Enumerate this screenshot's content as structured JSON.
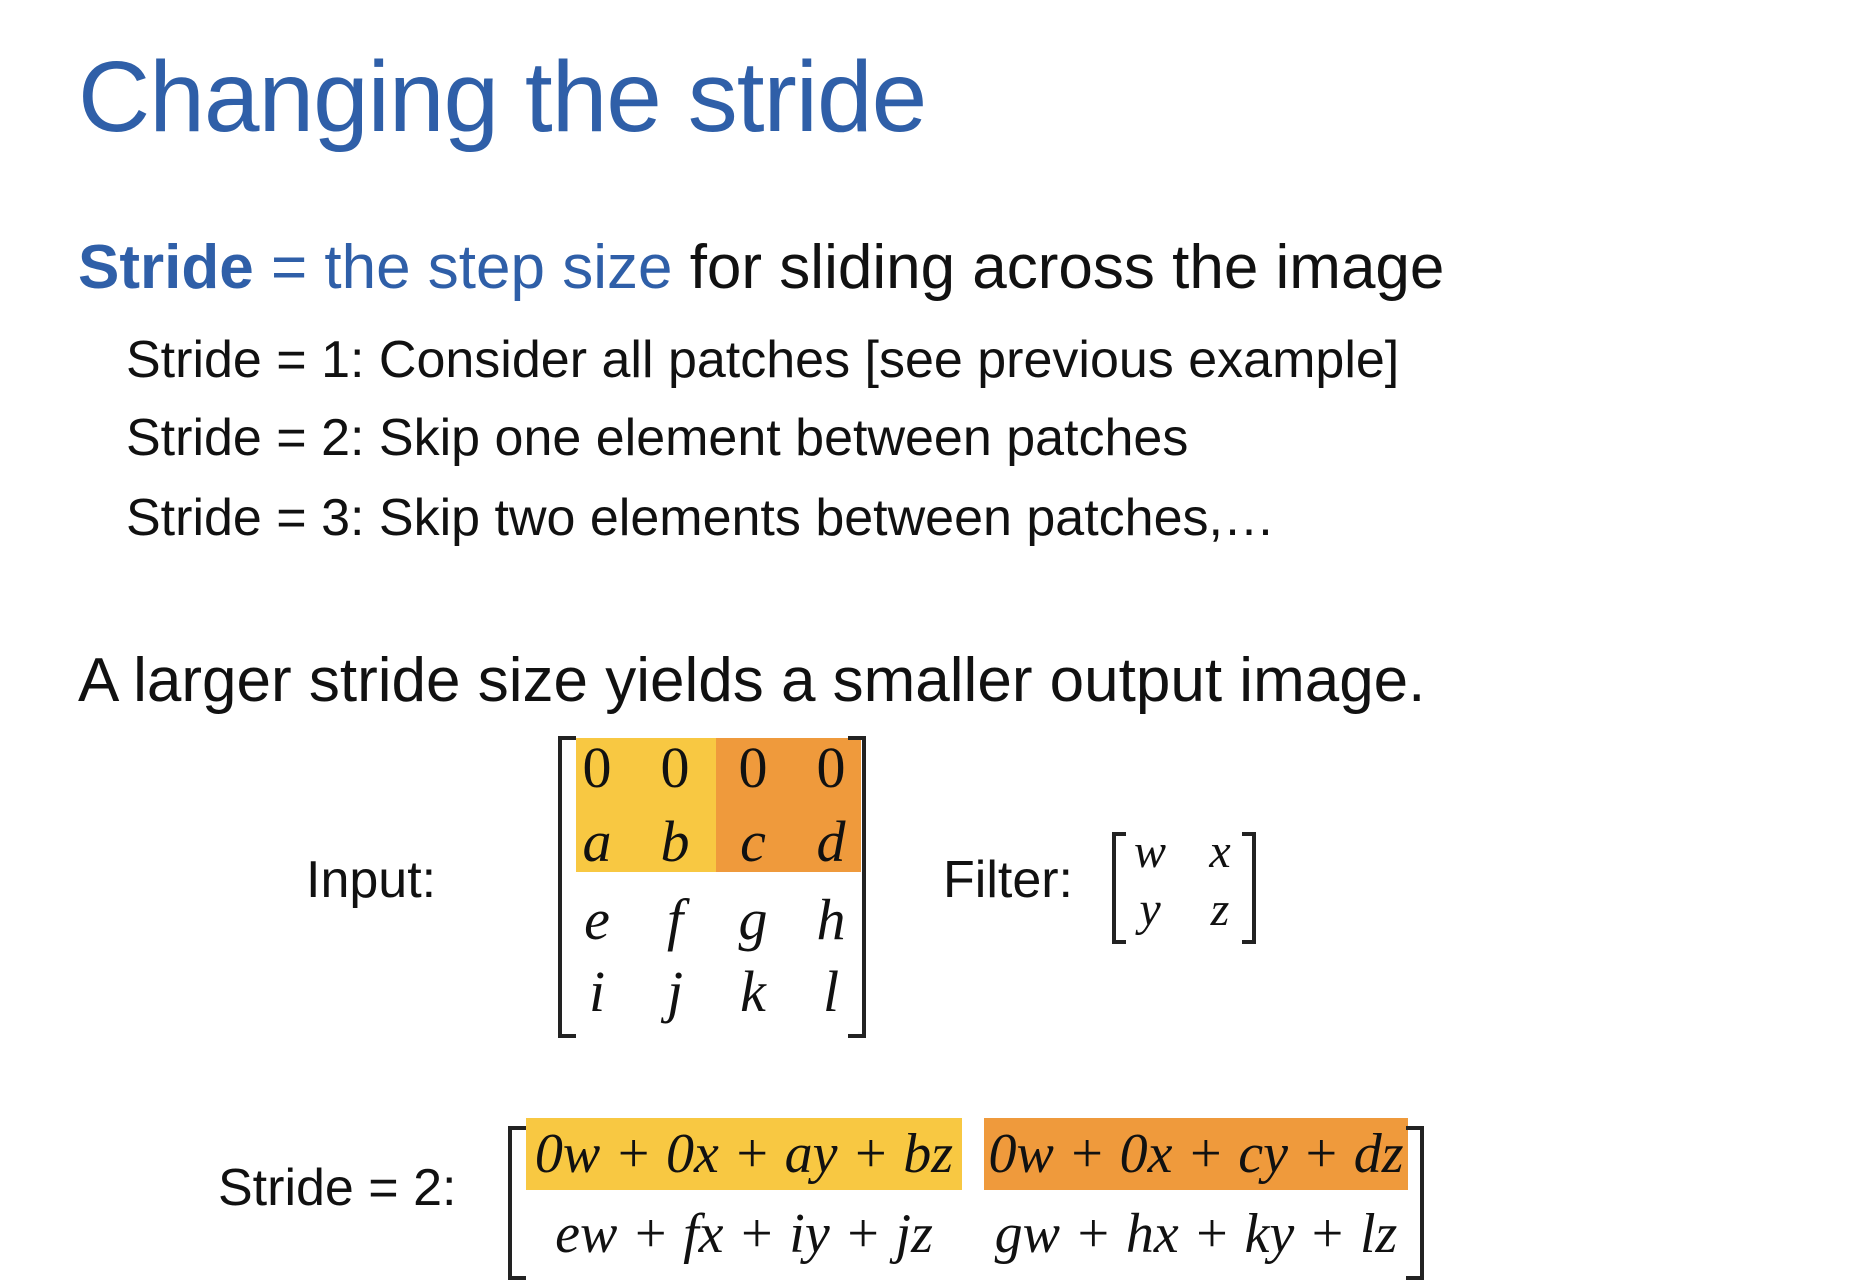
{
  "title": "Changing the stride",
  "definition": {
    "term": "Stride",
    "equals": " = ",
    "meaning": "the step size",
    "rest": " for sliding across the image"
  },
  "bullets": [
    "Stride = 1: Consider all patches [see previous example]",
    "Stride = 2: Skip one element between patches",
    "Stride = 3: Skip two elements between patches,…"
  ],
  "statement": "A larger stride size yields a smaller output image.",
  "input": {
    "label": "Input:",
    "matrix": [
      [
        "0",
        "0",
        "0",
        "0"
      ],
      [
        "a",
        "b",
        "c",
        "d"
      ],
      [
        "e",
        "f",
        "g",
        "h"
      ],
      [
        "i",
        "j",
        "k",
        "l"
      ]
    ]
  },
  "filter": {
    "label": "Filter:",
    "matrix": [
      [
        "w",
        "x"
      ],
      [
        "y",
        "z"
      ]
    ]
  },
  "output": {
    "label": "Stride = 2:",
    "matrix": [
      [
        "0w + 0x + ay + bz",
        "0w + 0x + cy + dz"
      ],
      [
        "ew + fx + iy + jz",
        "gw + hx + ky + lz"
      ]
    ]
  },
  "colors": {
    "title": "#2f5fa8",
    "highlight_first_patch": "#f8c842",
    "highlight_second_patch": "#ef9a3c"
  }
}
